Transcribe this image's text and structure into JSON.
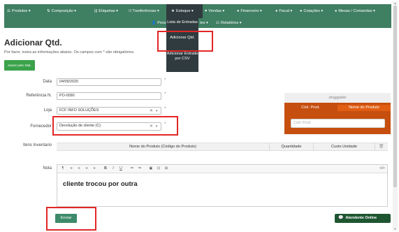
{
  "nav": {
    "items": [
      {
        "id": "produtos",
        "icon": "☰",
        "label": "Produtos ▾"
      },
      {
        "id": "composicao",
        "icon": "⇅",
        "label": "Composição ▾"
      },
      {
        "id": "etiquetas",
        "icon": "|||",
        "label": "Etiquetas ▾"
      },
      {
        "id": "transferencias",
        "icon": "⤨",
        "label": "Tranferências ▾"
      },
      {
        "id": "estoque",
        "icon": "★",
        "label": "Estoque ▾"
      },
      {
        "id": "vendas",
        "icon": "♥",
        "label": "Vendas ▾"
      },
      {
        "id": "financeiro",
        "icon": "●",
        "label": "Financeiro ▾"
      },
      {
        "id": "fiscal",
        "icon": "●",
        "label": "Fiscal ▾"
      },
      {
        "id": "cotacoes",
        "icon": "●",
        "label": "Cotações ▾"
      },
      {
        "id": "mesas",
        "icon": "●",
        "label": "Mesas / Comandas ▾"
      }
    ],
    "sub_items": [
      {
        "id": "pessoas",
        "icon": "👤",
        "label": "Pess"
      },
      {
        "id": "relatorios",
        "icon": "☷",
        "label": "Relatórios ▾"
      }
    ],
    "sub_fragment": "tes ▾",
    "estoque_menu": [
      "Lista de Entradas",
      "Adicionar Qtd.",
      "Adicionar Entrada por CSV"
    ]
  },
  "page": {
    "title": "Adicionar Qtd.",
    "instructions": "Por favor, insira as informações abaixo. Os campos com * são obrigatórios.",
    "xml_button": "Inserir pelo XML"
  },
  "form": {
    "data": {
      "label": "Data",
      "value": "04/09/2020"
    },
    "referencia": {
      "label": "Referência N.",
      "value": "PO-0090"
    },
    "loja": {
      "label": "Loja",
      "value": "FCF INFO SOLUÇÕES"
    },
    "fornecedor": {
      "label": "Fornecedor",
      "value": "Devolução de cliente (C)"
    },
    "required_mark": "*",
    "clear_mark": "✕",
    "caret": "▾"
  },
  "side_panel": {
    "drag_label": "draggable",
    "col_codigo": "Cód. Prod.",
    "col_nome": "Nome do Produto",
    "input_placeholder": "Cód. Prod."
  },
  "inventory": {
    "label": "Itens Inventario",
    "columns": [
      "Nome do Produto (Código do Produto)",
      "Quantidade",
      "Custo Unidade"
    ],
    "trash_icon": "🗑"
  },
  "nota": {
    "label": "Nota",
    "toolbar": [
      "¶",
      "≡",
      "≡",
      "≡",
      "≡",
      "B",
      "I",
      "U",
      "≔",
      "≔",
      "▣",
      "⊡",
      "⊞",
      "</>"
    ],
    "text": "cliente trocou por outra"
  },
  "actions": {
    "submit": "Enviar",
    "chat": "Atendente Online",
    "chat_icon": "💬"
  },
  "colors": {
    "nav": "#3f7f62",
    "nav_active": "#2f3b3e",
    "accent_orange": "#c64f0f",
    "highlight_red": "#e32626",
    "button_green": "#3d8a6a"
  }
}
